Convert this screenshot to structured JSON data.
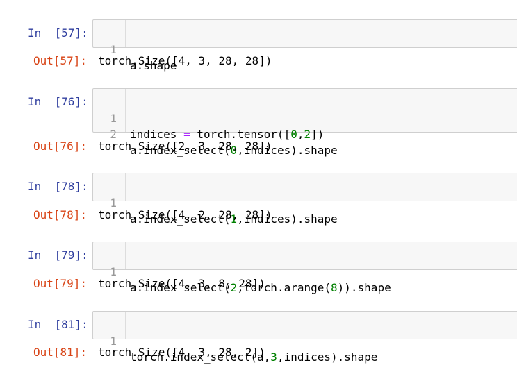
{
  "cells": [
    {
      "in_prompt": "In  [57]:",
      "lines": [
        {
          "no": "1",
          "tokens": [
            {
              "t": "a.shape",
              "k": "plain"
            }
          ]
        }
      ],
      "out_prompt": "Out[57]:",
      "output": "torch.Size([4, 3, 28, 28])"
    },
    {
      "in_prompt": "In  [76]:",
      "lines": [
        {
          "no": "1",
          "tokens": [
            {
              "t": "indices ",
              "k": "plain"
            },
            {
              "t": "=",
              "k": "op"
            },
            {
              "t": " torch.tensor([",
              "k": "plain"
            },
            {
              "t": "0",
              "k": "num"
            },
            {
              "t": ",",
              "k": "plain"
            },
            {
              "t": "2",
              "k": "num"
            },
            {
              "t": "])",
              "k": "plain"
            }
          ]
        },
        {
          "no": "2",
          "tokens": [
            {
              "t": "a.index_select(",
              "k": "plain"
            },
            {
              "t": "0",
              "k": "num"
            },
            {
              "t": ",indices).shape",
              "k": "plain"
            }
          ]
        }
      ],
      "out_prompt": "Out[76]:",
      "output": "torch.Size([2, 3, 28, 28])"
    },
    {
      "in_prompt": "In  [78]:",
      "lines": [
        {
          "no": "1",
          "tokens": [
            {
              "t": "a.index_select(",
              "k": "plain"
            },
            {
              "t": "1",
              "k": "num"
            },
            {
              "t": ",indices).shape",
              "k": "plain"
            }
          ]
        }
      ],
      "out_prompt": "Out[78]:",
      "output": "torch.Size([4, 2, 28, 28])"
    },
    {
      "in_prompt": "In  [79]:",
      "lines": [
        {
          "no": "1",
          "tokens": [
            {
              "t": "a.index_select(",
              "k": "plain"
            },
            {
              "t": "2",
              "k": "num"
            },
            {
              "t": ",torch.arange(",
              "k": "plain"
            },
            {
              "t": "8",
              "k": "num"
            },
            {
              "t": ")).shape",
              "k": "plain"
            }
          ]
        }
      ],
      "out_prompt": "Out[79]:",
      "output": "torch.Size([4, 3, 8, 28])"
    },
    {
      "in_prompt": "In  [81]:",
      "lines": [
        {
          "no": "1",
          "tokens": [
            {
              "t": "torch.index_select(a,",
              "k": "plain"
            },
            {
              "t": "3",
              "k": "num"
            },
            {
              "t": ",indices).shape",
              "k": "plain"
            }
          ]
        }
      ],
      "out_prompt": "Out[81]:",
      "output": "torch.Size([4, 3, 28, 2])"
    }
  ],
  "colors": {
    "in_prompt": "#303f9f",
    "out_prompt": "#d84315",
    "operator": "#aa22ff",
    "number": "#008000",
    "input_background": "#f7f7f7",
    "input_border": "#cfcfcf"
  }
}
